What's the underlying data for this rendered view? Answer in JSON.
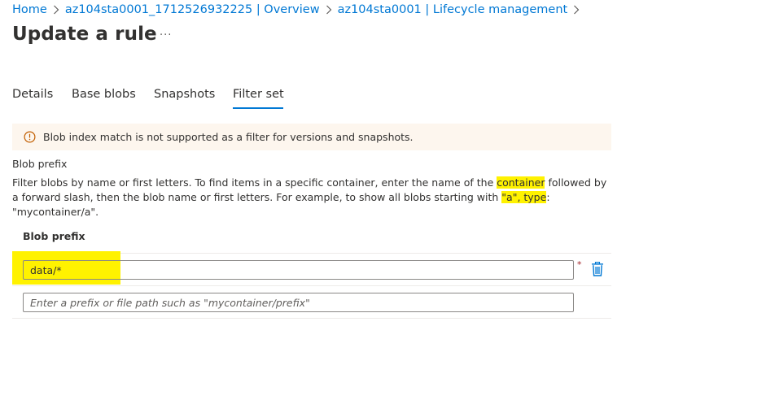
{
  "breadcrumb": {
    "items": [
      "Home",
      "az104sta0001_1712526932225 | Overview",
      "az104sta0001 | Lifecycle management"
    ]
  },
  "page": {
    "title": "Update a rule",
    "more_label": "···"
  },
  "tabs": [
    {
      "label": "Details",
      "active": false
    },
    {
      "label": "Base blobs",
      "active": false
    },
    {
      "label": "Snapshots",
      "active": false
    },
    {
      "label": "Filter set",
      "active": true
    }
  ],
  "banner": {
    "icon": "info-icon",
    "text": "Blob index match is not supported as a filter for versions and snapshots."
  },
  "blob_prefix": {
    "section_label": "Blob prefix",
    "description_parts": [
      "Filter blobs by name or first letters. To find items in a specific container, enter the name of the ",
      "container",
      " followed by a forward slash, then the blob name or first letters. For example, to show all blobs starting with ",
      "\"a\", type",
      ": \"mycontainer/a\"."
    ],
    "column_header": "Blob prefix",
    "rows": [
      {
        "value": "data/*",
        "required_mark": "*"
      },
      {
        "value": "",
        "placeholder": "Enter a prefix or file path such as \"mycontainer/prefix\""
      }
    ]
  },
  "colors": {
    "link": "#0078d4",
    "highlight": "#fff200",
    "banner_bg": "#fdf6ee",
    "warning_icon": "#c25e00",
    "delete_icon": "#0078d4",
    "required": "#a4262c"
  }
}
